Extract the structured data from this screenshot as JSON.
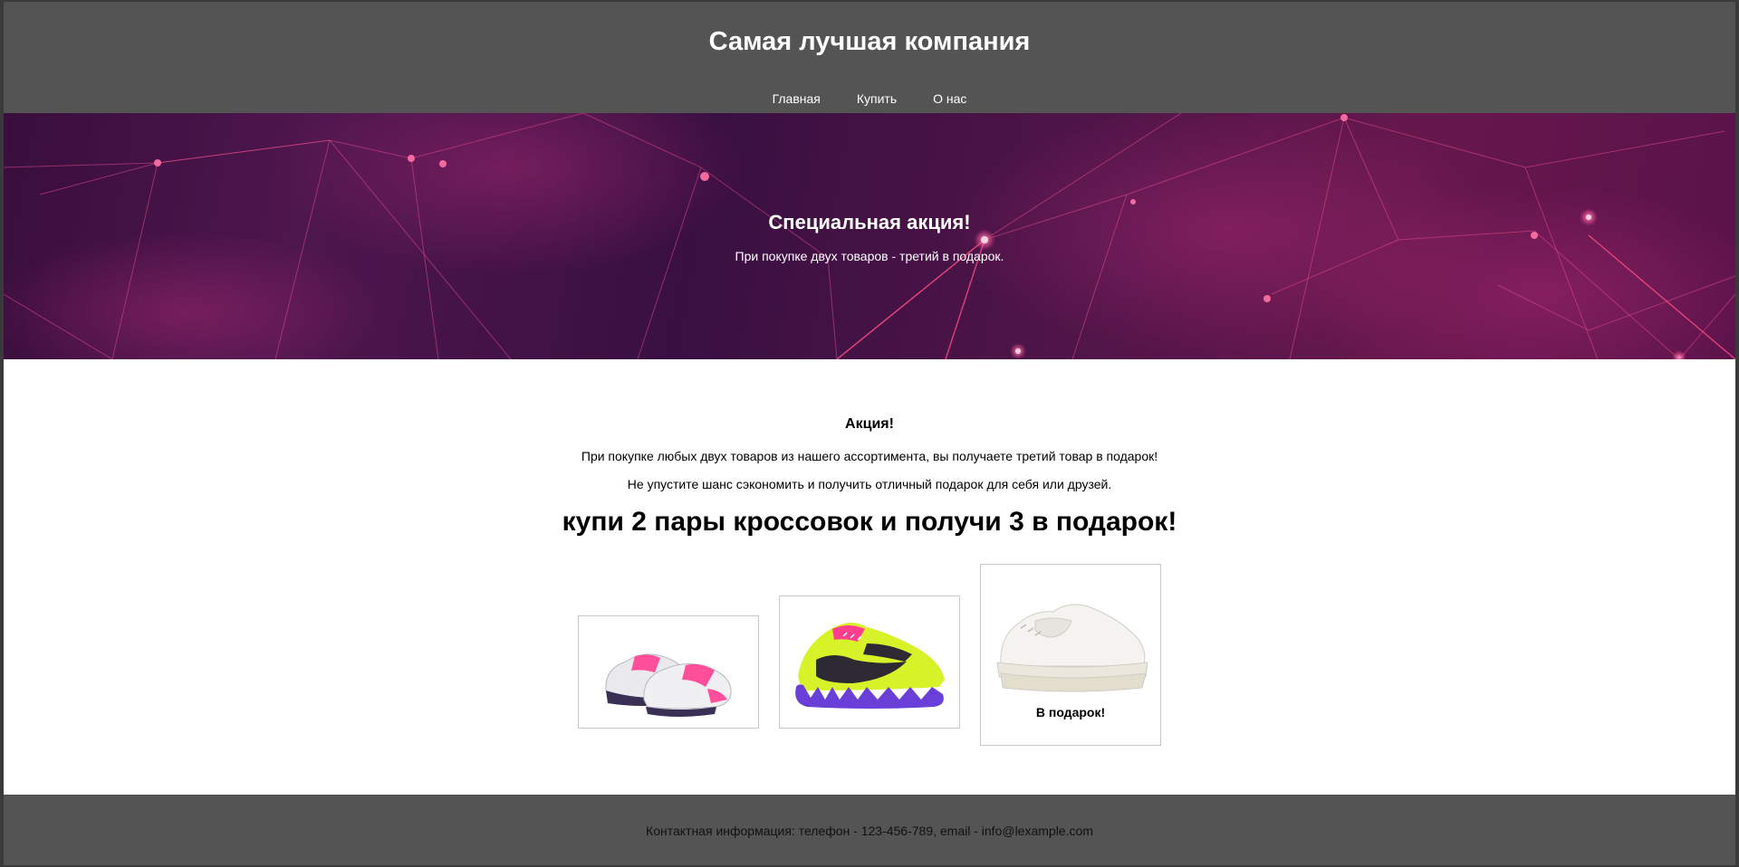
{
  "header": {
    "title": "Самая лучшая компания",
    "nav": [
      "Главная",
      "Купить",
      "О нас"
    ]
  },
  "banner": {
    "title": "Специальная акция!",
    "text": "При покупке двух товаров - третий в подарок."
  },
  "promo": {
    "title": "Акция!",
    "line1": "При покупке любых двух товаров из нашего ассортимента, вы получаете третий товар в подарок!",
    "line2": "Не упустите шанс сэкономить и получить отличный подарок для себя или друзей.",
    "headline": "купи 2 пары кроссовок и получи 3 в подарок!"
  },
  "products": [
    {
      "name": "pink-white-sneakers-image",
      "label": ""
    },
    {
      "name": "neon-purple-sneaker-image",
      "label": ""
    },
    {
      "name": "white-chunky-sneaker-image",
      "label": "В подарок!"
    }
  ],
  "footer": {
    "contact": "Контактная информация: телефон - 123-456-789, email - info@lexample.com"
  },
  "colors": {
    "header_bg": "#545454",
    "footer_bg": "#545454",
    "banner_accent": "#e0306e"
  }
}
